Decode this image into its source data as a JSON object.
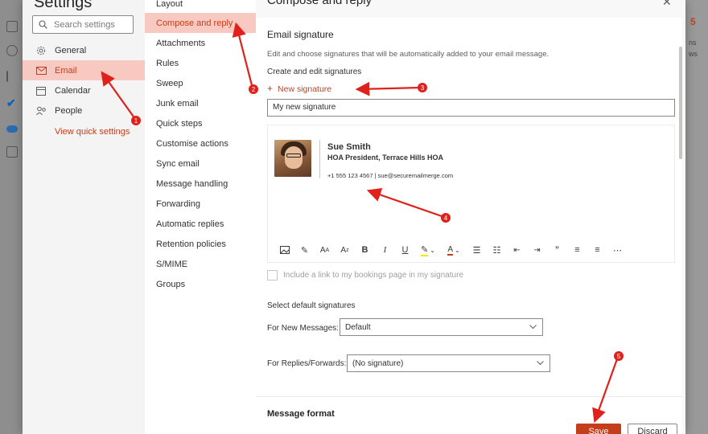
{
  "settings": {
    "title": "Settings",
    "search_placeholder": "Search settings",
    "nav": [
      {
        "label": "General",
        "icon": "gear-icon"
      },
      {
        "label": "Email",
        "icon": "mail-icon"
      },
      {
        "label": "Calendar",
        "icon": "calendar-icon"
      },
      {
        "label": "People",
        "icon": "people-icon"
      }
    ],
    "quick_link": "View quick settings"
  },
  "email_nav": [
    "Layout",
    "Compose and reply",
    "Attachments",
    "Rules",
    "Sweep",
    "Junk email",
    "Quick steps",
    "Customise actions",
    "Sync email",
    "Message handling",
    "Forwarding",
    "Automatic replies",
    "Retention policies",
    "S/MIME",
    "Groups"
  ],
  "content": {
    "title": "Compose and reply",
    "section_signature": "Email signature",
    "description": "Edit and choose signatures that will be automatically added to your email message.",
    "create_edit": "Create and edit signatures",
    "new_signature": "New signature",
    "signature_name": "My new signature",
    "signature": {
      "name": "Sue Smith",
      "title": "HOA President, Terrace Hills HOA",
      "contact": "+1 555 123 4567  |  sue@securemailmerge.com"
    },
    "bookings_checkbox": "Include a link to my bookings page in my signature",
    "default_heading": "Select default signatures",
    "new_messages_label": "For New Messages:",
    "new_messages_value": "Default",
    "replies_label": "For Replies/Forwards:",
    "replies_value": "(No signature)",
    "message_format": "Message format",
    "save_label": "Save",
    "discard_label": "Discard"
  },
  "toolbar_icons": [
    "image-icon",
    "format-painter-icon",
    "font-size-icon",
    "superscript-icon",
    "bold-icon",
    "italic-icon",
    "underline-icon",
    "highlight-icon",
    "font-color-icon",
    "bullets-icon",
    "numbering-icon",
    "decrease-indent-icon",
    "increase-indent-icon",
    "quote-icon",
    "align-left-icon",
    "align-center-icon",
    "more-icon"
  ],
  "annotations": [
    "1",
    "2",
    "3",
    "4",
    "5"
  ],
  "colors": {
    "accent": "#c43e1c",
    "active_bg": "#f7c9c0",
    "arrow": "#e0201b"
  }
}
